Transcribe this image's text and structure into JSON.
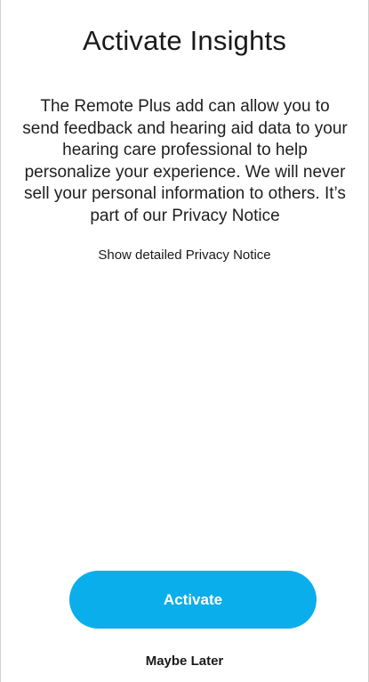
{
  "screen": {
    "title": "Activate Insights",
    "description": "The Remote Plus add can allow you to send feedback and hearing aid data to your hearing care professional to help personalize your experience. We will never sell your personal information to others. It’s part of our Privacy Notice",
    "privacy_link_label": "Show detailed Privacy Notice",
    "activate_label": "Activate",
    "maybe_later_label": "Maybe Later"
  },
  "colors": {
    "primary_button": "#0aaeea",
    "text": "#1a1a1a",
    "background": "#ffffff"
  }
}
